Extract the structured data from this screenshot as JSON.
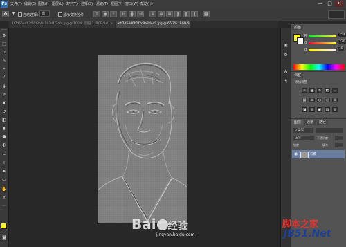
{
  "app": {
    "logo": "Ps"
  },
  "menu": [
    "文件(F)",
    "编辑(E)",
    "图像(I)",
    "图层(L)",
    "文字(Y)",
    "选择(S)",
    "滤镜(T)",
    "视图(V)",
    "窗口(W)",
    "帮助(H)"
  ],
  "window_controls": {
    "minimize": "—",
    "restore": "□",
    "close": "✕"
  },
  "options": {
    "auto_select_label": "自动选择：",
    "auto_select_value": "组",
    "show_transform_label": "显示变换控件"
  },
  "tabs": [
    {
      "label": "1f7d55ed63fb5f3b9a1b3d4f7dfa.jpg @ 100% (图层 1, RGB/8#) ×"
    },
    {
      "label": "eb7d54d0b1f2c9a3de49.jpg @ 66.7% (RGB/8) ×"
    }
  ],
  "tools": [
    "move-icon",
    "marquee-icon",
    "lasso-icon",
    "quick-select-icon",
    "crop-icon",
    "eyedropper-icon",
    "healing-icon",
    "brush-icon",
    "stamp-icon",
    "history-brush-icon",
    "eraser-icon",
    "gradient-icon",
    "blur-icon",
    "dodge-icon",
    "pen-icon",
    "type-icon",
    "path-select-icon",
    "shape-icon",
    "hand-icon",
    "zoom-icon"
  ],
  "color_panel": {
    "tab": "颜色",
    "channels": [
      {
        "label": "R",
        "value": "254",
        "color": "#ff0000"
      },
      {
        "label": "G",
        "value": "236",
        "color": "#00ff00"
      },
      {
        "label": "B",
        "value": "45",
        "color": "#0000ff"
      }
    ],
    "foreground": "#fef02d",
    "background": "#ffffff"
  },
  "adjust_panel": {
    "tab": "调整",
    "title": "添加调整"
  },
  "layers_panel": {
    "tabs": [
      "图层",
      "通道",
      "路径"
    ],
    "filter_label": "ρ 类型",
    "blend_mode": "正常",
    "opacity_label": "不透明度",
    "lock_label": "锁定",
    "fill_label": "填充",
    "layer_name": "背景"
  },
  "watermarks": {
    "site_cn": "脚本之家",
    "site_url": "JB51.Net",
    "baidu": "Bai",
    "baidu2": "经验",
    "jingyan": "jingyan.baidu.com"
  }
}
